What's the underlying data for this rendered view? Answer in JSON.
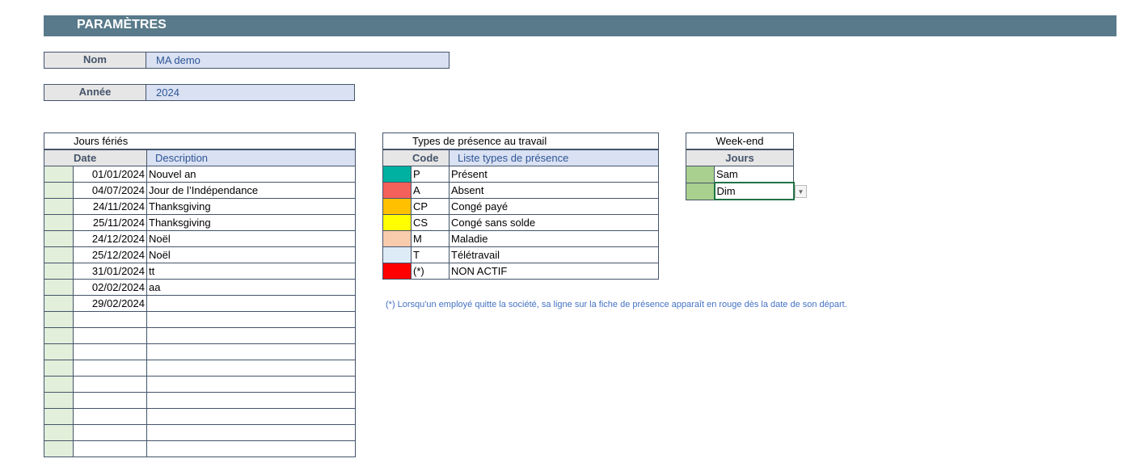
{
  "header": {
    "title": "PARAMÈTRES"
  },
  "nom": {
    "label": "Nom",
    "value": "MA demo"
  },
  "annee": {
    "label": "Année",
    "value": "2024"
  },
  "holidays": {
    "title": "Jours fériés",
    "col_date": "Date",
    "col_desc": "Description",
    "rows": [
      {
        "date": "01/01/2024",
        "desc": "Nouvel an"
      },
      {
        "date": "04/07/2024",
        "desc": "Jour de l’Indépendance"
      },
      {
        "date": "24/11/2024",
        "desc": "Thanksgiving"
      },
      {
        "date": "25/11/2024",
        "desc": "Thanksgiving"
      },
      {
        "date": "24/12/2024",
        "desc": "Noël"
      },
      {
        "date": "25/12/2024",
        "desc": "Noël"
      },
      {
        "date": "31/01/2024",
        "desc": "tt"
      },
      {
        "date": "02/02/2024",
        "desc": "aa"
      },
      {
        "date": "29/02/2024",
        "desc": ""
      },
      {
        "date": "",
        "desc": ""
      },
      {
        "date": "",
        "desc": ""
      },
      {
        "date": "",
        "desc": ""
      },
      {
        "date": "",
        "desc": ""
      },
      {
        "date": "",
        "desc": ""
      },
      {
        "date": "",
        "desc": ""
      },
      {
        "date": "",
        "desc": ""
      },
      {
        "date": "",
        "desc": ""
      },
      {
        "date": "",
        "desc": ""
      }
    ]
  },
  "presence": {
    "title": "Types de présence au travail",
    "col_code": "Code",
    "col_desc": "Liste types de présence",
    "rows": [
      {
        "color": "#00b0a0",
        "code": "P",
        "desc": "Présent"
      },
      {
        "color": "#f4605a",
        "code": "A",
        "desc": "Absent"
      },
      {
        "color": "#ffc000",
        "code": "CP",
        "desc": "Congé payé"
      },
      {
        "color": "#ffff00",
        "code": "CS",
        "desc": "Congé sans solde"
      },
      {
        "color": "#f8cbad",
        "code": "M",
        "desc": "Maladie"
      },
      {
        "color": "#ddebf7",
        "code": "T",
        "desc": "Télétravail"
      },
      {
        "color": "#ff0000",
        "code": "(*)",
        "desc": "NON ACTIF"
      }
    ],
    "note": "(*) Lorsqu'un employé quitte la société, sa ligne sur la fiche de présence apparaît en rouge dès la date de son départ."
  },
  "weekend": {
    "title": "Week-end",
    "col_days": "Jours",
    "color": "#a9d08e",
    "rows": [
      "Sam",
      "Dim"
    ]
  }
}
